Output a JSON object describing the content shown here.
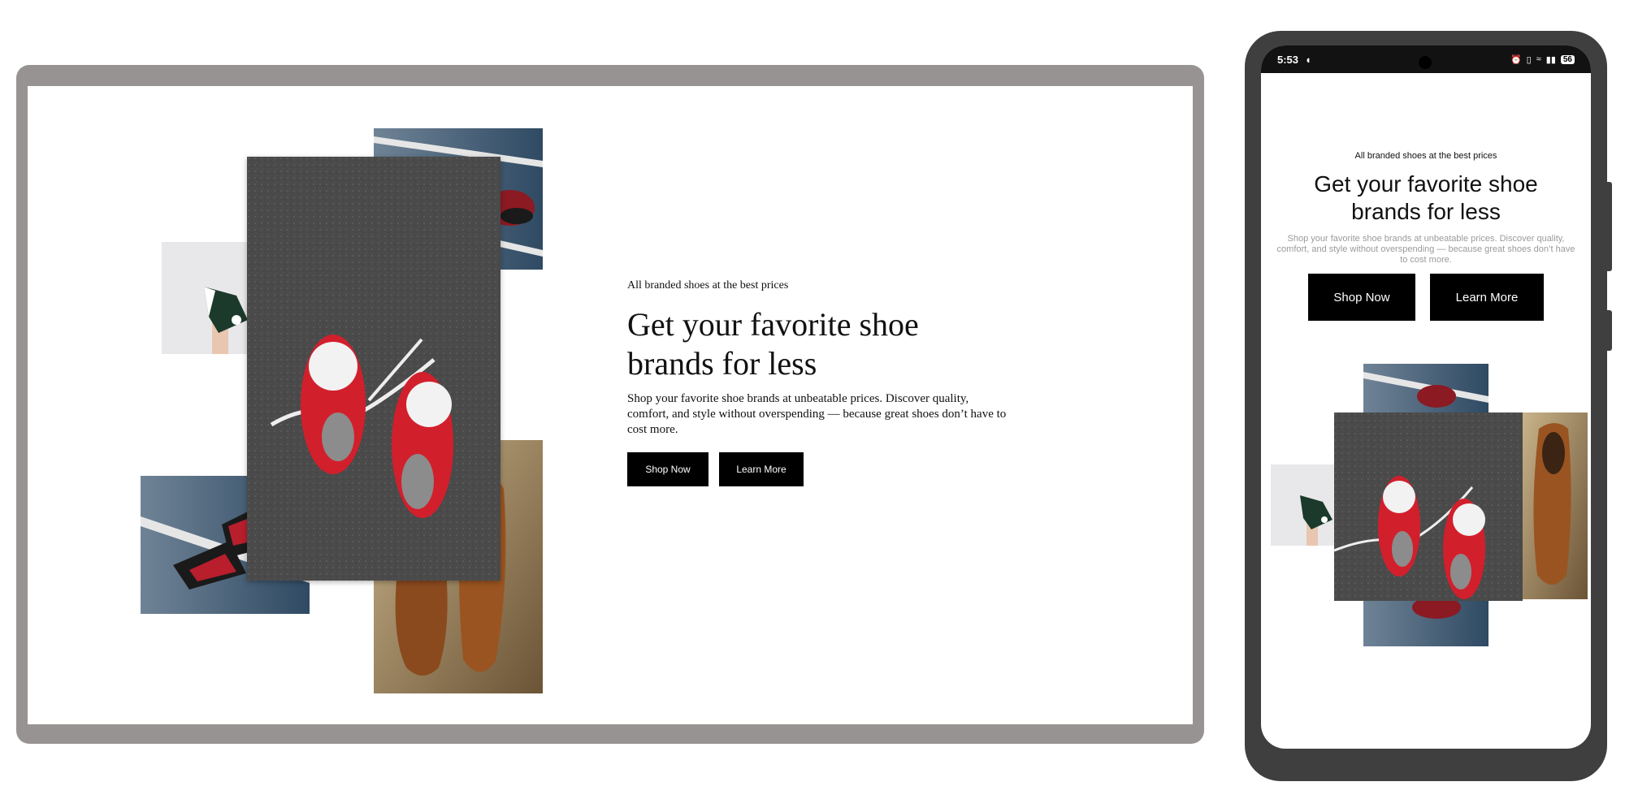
{
  "hero": {
    "eyebrow": "All branded shoes at the best prices",
    "title_line1": "Get your favorite shoe",
    "title_line2": "brands for less",
    "description": "Shop your favorite shoe brands at unbeatable prices. Discover quality, comfort, and style without overspending — because great shoes don’t have to cost more.",
    "shop_now": "Shop Now",
    "learn_more": "Learn More"
  },
  "phone_status": {
    "time": "5:53",
    "battery": "56"
  },
  "images": {
    "main": "red-sneakers-on-asphalt-photo",
    "top_right": "sneakers-on-court-photo",
    "left_small": "high-top-sneaker-photo",
    "bottom_left": "sneakers-on-court-photo",
    "bottom_right": "brown-leather-shoes-photo"
  },
  "colors": {
    "button_bg": "#000000",
    "frame_desktop": "#979393",
    "frame_phone": "#3f3f3f"
  }
}
